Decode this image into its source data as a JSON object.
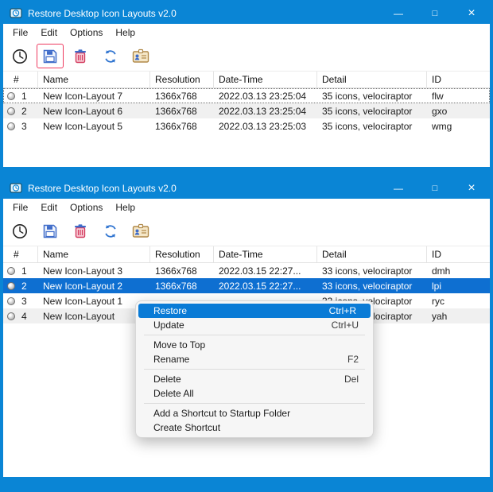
{
  "app": {
    "title": "Restore Desktop Icon Layouts v2.0"
  },
  "icons": {
    "minimize": "—",
    "maximize": "□",
    "close": "×",
    "toolbar": [
      "clock-restore-icon",
      "save-layout-icon",
      "delete-trash-icon",
      "refresh-icon",
      "id-badge-icon"
    ]
  },
  "colors": {
    "titlebar": "#0a85d5",
    "row_selection": "#0e6fd1",
    "context_menu_highlight": "#0a7bd6",
    "toolbar_highlight_border": "#ee3a5f"
  },
  "menu_bar": {
    "items": [
      "File",
      "Edit",
      "Options",
      "Help"
    ]
  },
  "table": {
    "headers": [
      "#",
      "Name",
      "Resolution",
      "Date-Time",
      "Detail",
      "ID"
    ]
  },
  "window1": {
    "rows": [
      {
        "num": "1",
        "name": "New Icon-Layout 7",
        "resolution": "1366x768",
        "datetime": "2022.03.13 23:25:04",
        "detail": "35 icons, velociraptor",
        "id": "flw"
      },
      {
        "num": "2",
        "name": "New Icon-Layout 6",
        "resolution": "1366x768",
        "datetime": "2022.03.13 23:25:04",
        "detail": "35 icons, velociraptor",
        "id": "gxo"
      },
      {
        "num": "3",
        "name": "New Icon-Layout 5",
        "resolution": "1366x768",
        "datetime": "2022.03.13 23:25:03",
        "detail": "35 icons, velociraptor",
        "id": "wmg"
      }
    ]
  },
  "window2": {
    "rows": [
      {
        "num": "1",
        "name": "New Icon-Layout 3",
        "resolution": "1366x768",
        "datetime": "2022.03.15 22:27...",
        "detail": "33 icons, velociraptor",
        "id": "dmh"
      },
      {
        "num": "2",
        "name": "New Icon-Layout 2",
        "resolution": "1366x768",
        "datetime": "2022.03.15 22:27...",
        "detail": "33 icons, velociraptor",
        "id": "lpi"
      },
      {
        "num": "3",
        "name": "New Icon-Layout 1",
        "resolution": "",
        "datetime": "",
        "detail": "33 icons, velociraptor",
        "id": "ryc"
      },
      {
        "num": "4",
        "name": "New Icon-Layout",
        "resolution": "",
        "datetime": "",
        "detail": "33 icons, velociraptor",
        "id": "yah"
      }
    ]
  },
  "context_menu": {
    "items": [
      {
        "label": "Restore",
        "shortcut": "Ctrl+R"
      },
      {
        "label": "Update",
        "shortcut": "Ctrl+U"
      },
      {
        "label": "Move to Top",
        "shortcut": ""
      },
      {
        "label": "Rename",
        "shortcut": "F2"
      },
      {
        "label": "Delete",
        "shortcut": "Del"
      },
      {
        "label": "Delete All",
        "shortcut": ""
      },
      {
        "label": "Add a Shortcut to Startup Folder",
        "shortcut": ""
      },
      {
        "label": "Create Shortcut",
        "shortcut": ""
      }
    ]
  }
}
